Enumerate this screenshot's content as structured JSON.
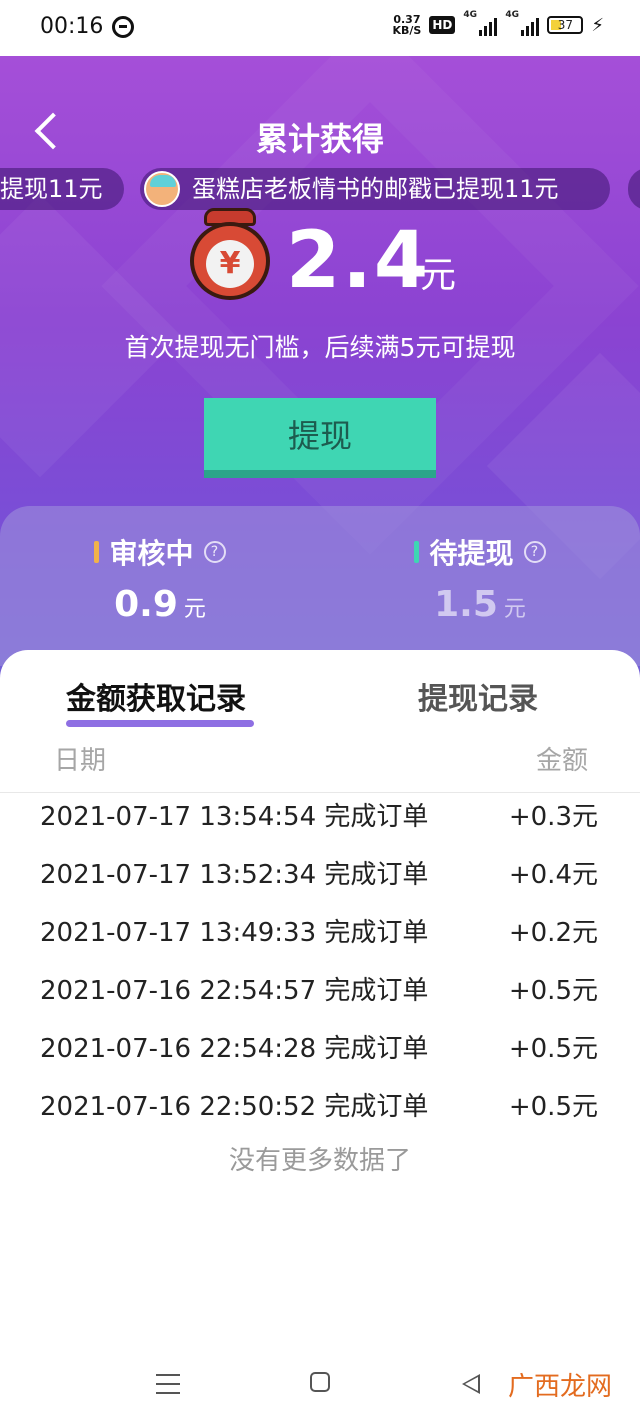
{
  "status_bar": {
    "time": "00:16",
    "speed_top": "0.37",
    "speed_bottom": "KB/S",
    "hd": "HD",
    "signal1": "4G",
    "signal2": "4G",
    "battery": "37"
  },
  "header": {
    "title": "累计获得",
    "ticker_left": "提现11元",
    "ticker_main": "蛋糕店老板情书的邮戳已提现11元"
  },
  "balance": {
    "amount": "2.4",
    "unit": "元",
    "coin_symbol": "¥",
    "hint": "首次提现无门槛，后续满5元可提现",
    "withdraw_label": "提现"
  },
  "summary": {
    "reviewing_label": "审核中",
    "reviewing_value": "0.9",
    "pending_label": "待提现",
    "pending_value": "1.5",
    "unit": "元",
    "help": "?"
  },
  "tabs": {
    "active": "金额获取记录",
    "inactive": "提现记录"
  },
  "table": {
    "date_header": "日期",
    "amount_header": "金额",
    "rows": [
      {
        "desc": "2021-07-17 13:54:54 完成订单",
        "amount": "+0.3元"
      },
      {
        "desc": "2021-07-17 13:52:34 完成订单",
        "amount": "+0.4元"
      },
      {
        "desc": "2021-07-17 13:49:33 完成订单",
        "amount": "+0.2元"
      },
      {
        "desc": "2021-07-16 22:54:57 完成订单",
        "amount": "+0.5元"
      },
      {
        "desc": "2021-07-16 22:54:28 完成订单",
        "amount": "+0.5元"
      },
      {
        "desc": "2021-07-16 22:50:52 完成订单",
        "amount": "+0.5元"
      }
    ],
    "no_more": "没有更多数据了"
  },
  "watermark": "广西龙网",
  "colors": {
    "accent_green": "#3fd6b3",
    "tab_underline": "#8e6fe3",
    "header_purple": "#8b43d2"
  }
}
